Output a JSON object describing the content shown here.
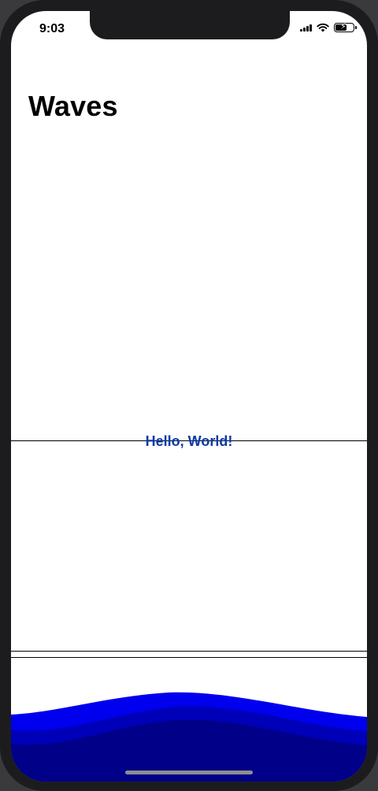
{
  "status_bar": {
    "time": "9:03",
    "battery_level": 0.6
  },
  "navigation": {
    "title": "Waves"
  },
  "content": {
    "message": "Hello, World!"
  },
  "waves": {
    "colors": [
      "#0000ee",
      "#0000b8",
      "#000088"
    ]
  },
  "icons": [
    "signal-icon",
    "wifi-icon",
    "battery-icon",
    "bolt-icon"
  ]
}
